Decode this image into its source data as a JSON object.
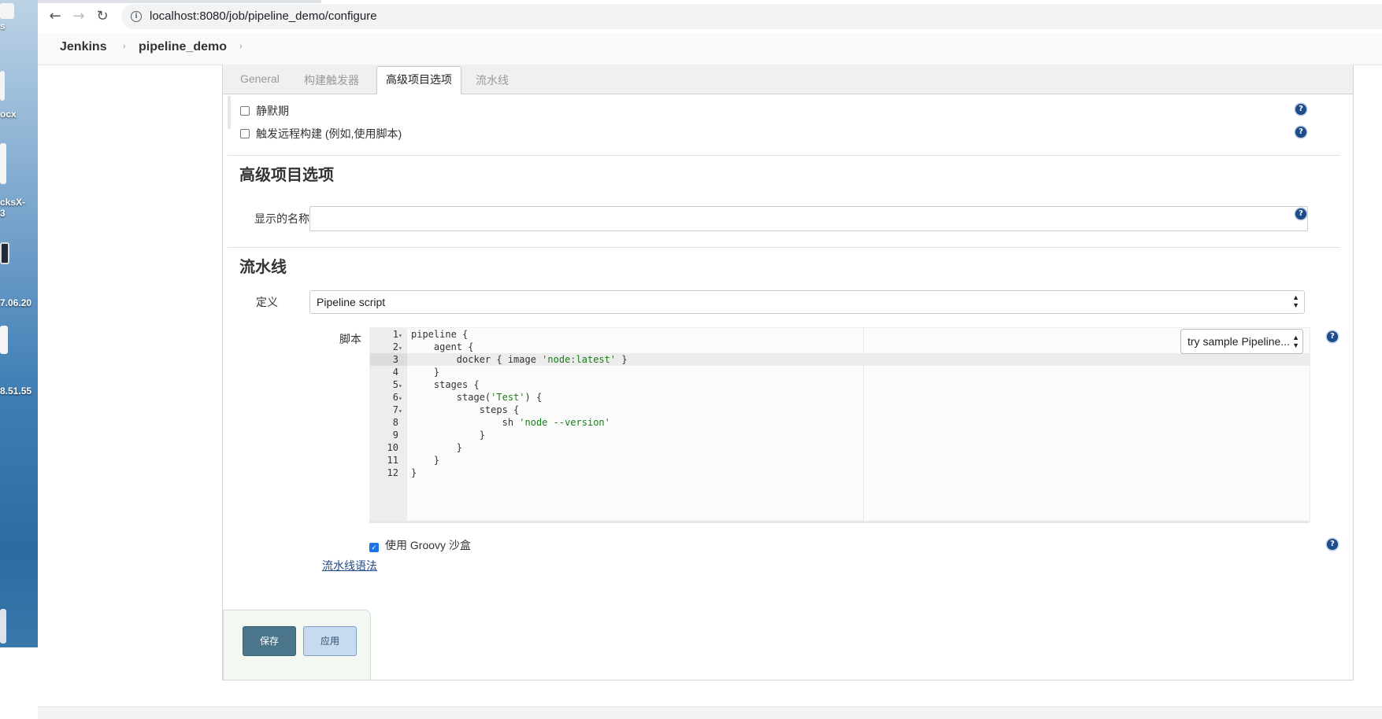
{
  "desktop": {
    "labels": [
      "ocx",
      "cksX-",
      "3",
      "7.06.20",
      "8.51.55",
      "s"
    ]
  },
  "browser": {
    "url": "localhost:8080/job/pipeline_demo/configure",
    "icons": {
      "back": "back-arrow-icon",
      "forward": "forward-arrow-icon",
      "reload": "reload-icon",
      "info": "info-icon"
    }
  },
  "breadcrumb": {
    "items": [
      "Jenkins",
      "pipeline_demo"
    ],
    "separator": "›"
  },
  "tabs": [
    "General",
    "构建触发器",
    "高级项目选项",
    "流水线"
  ],
  "triggers": {
    "quiet_period": "静默期",
    "remote_build": "触发远程构建 (例如,使用脚本)"
  },
  "advanced": {
    "heading": "高级项目选项",
    "display_name_label": "显示的名称",
    "display_name_value": ""
  },
  "pipeline": {
    "heading": "流水线",
    "definition_label": "定义",
    "definition_value": "Pipeline script",
    "script_label": "脚本",
    "sample_select": "try sample Pipeline...",
    "sandbox_label": "使用 Groovy 沙盒",
    "sandbox_checked": true,
    "syntax_link": "流水线语法",
    "code_lines": [
      {
        "n": "1",
        "fold": true,
        "indent": "",
        "pre": "pipeline {",
        "str": "",
        "post": ""
      },
      {
        "n": "2",
        "fold": true,
        "indent": "    ",
        "pre": "agent {",
        "str": "",
        "post": ""
      },
      {
        "n": "3",
        "fold": false,
        "indent": "        ",
        "pre": "docker { image ",
        "str": "'node:latest'",
        "post": " }"
      },
      {
        "n": "4",
        "fold": false,
        "indent": "    ",
        "pre": "}",
        "str": "",
        "post": ""
      },
      {
        "n": "5",
        "fold": true,
        "indent": "    ",
        "pre": "stages {",
        "str": "",
        "post": ""
      },
      {
        "n": "6",
        "fold": true,
        "indent": "        ",
        "pre": "stage(",
        "str": "'Test'",
        "post": ") {"
      },
      {
        "n": "7",
        "fold": true,
        "indent": "            ",
        "pre": "steps {",
        "str": "",
        "post": ""
      },
      {
        "n": "8",
        "fold": false,
        "indent": "                ",
        "pre": "sh ",
        "str": "'node --version'",
        "post": ""
      },
      {
        "n": "9",
        "fold": false,
        "indent": "            ",
        "pre": "}",
        "str": "",
        "post": ""
      },
      {
        "n": "10",
        "fold": false,
        "indent": "        ",
        "pre": "}",
        "str": "",
        "post": ""
      },
      {
        "n": "11",
        "fold": false,
        "indent": "    ",
        "pre": "}",
        "str": "",
        "post": ""
      },
      {
        "n": "12",
        "fold": false,
        "indent": "",
        "pre": "}",
        "str": "",
        "post": ""
      }
    ],
    "active_line": 3
  },
  "buttons": {
    "save": "保存",
    "apply": "应用"
  },
  "colors": {
    "save_button": "#4b758b",
    "apply_button": "#c8daf0",
    "help_icon": "#1e4c8a",
    "string_literal": "#1a7a1a"
  }
}
